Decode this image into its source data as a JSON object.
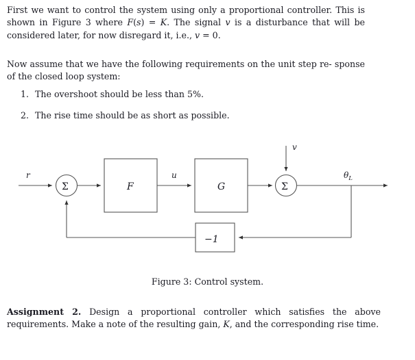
{
  "document": {
    "paragraph_1": {
      "line_1": "First we want to control the system using only a proportional controller.",
      "line_2_a": "This is shown in Figure 3 where ",
      "line_2_math_1": "F",
      "line_2_b": "(",
      "line_2_math_2": "s",
      "line_2_c": ") = ",
      "line_2_math_3": "K",
      "line_2_d": ". The signal ",
      "line_2_math_4": "v",
      "line_2_e": " is a disturbance",
      "line_3_a": "that will be considered later, for now disregard it, i.e., ",
      "line_3_math_1": "v",
      "line_3_b": " = 0."
    },
    "paragraph_2": {
      "line_1": "Now assume that we have the following requirements on the unit step re-",
      "line_2": "sponse of the closed loop system:"
    },
    "requirements": [
      {
        "number": "1.",
        "text": "The overshoot should be less than 5%."
      },
      {
        "number": "2.",
        "text": "The rise time should be as short as possible."
      }
    ],
    "figure_caption": "Figure 3: Control system.",
    "assignment": {
      "heading": "Assignment 2.",
      "body_a": " Design a proportional controller which satisfies the above requirements. Make a note of the resulting gain, ",
      "body_math": "K",
      "body_b": ", and the corresponding rise time."
    }
  },
  "diagram": {
    "title": "Control system block diagram",
    "signals": {
      "reference": "r",
      "control": "u",
      "disturbance": "v",
      "output_base": "θ",
      "output_sub": "L"
    },
    "blocks": [
      {
        "id": "controller",
        "label": "F"
      },
      {
        "id": "plant",
        "label": "G"
      },
      {
        "id": "feedback-gain",
        "label": "−1"
      }
    ],
    "summing_junctions": [
      {
        "id": "input-sum",
        "label": "Σ"
      },
      {
        "id": "disturbance-sum",
        "label": "Σ"
      }
    ],
    "colors": {
      "line": "#555555",
      "ink": "#1a1a22",
      "background": "#ffffff"
    }
  }
}
